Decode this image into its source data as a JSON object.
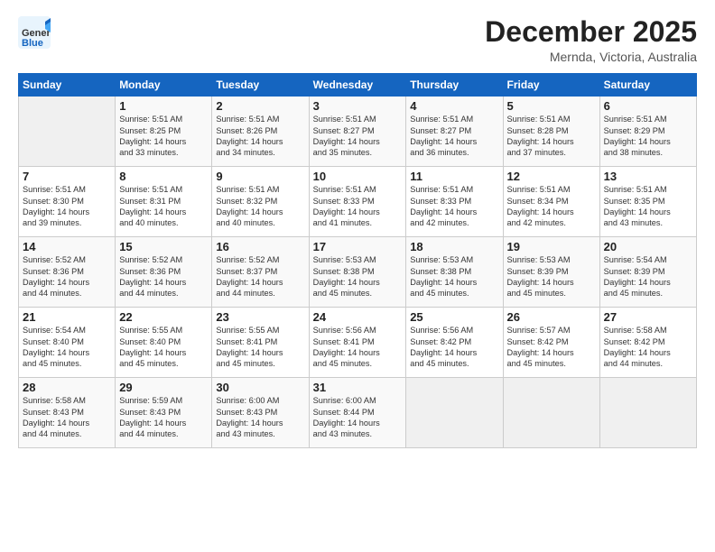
{
  "header": {
    "logo_line1": "General",
    "logo_line2": "Blue",
    "month_title": "December 2025",
    "location": "Mernda, Victoria, Australia"
  },
  "weekdays": [
    "Sunday",
    "Monday",
    "Tuesday",
    "Wednesday",
    "Thursday",
    "Friday",
    "Saturday"
  ],
  "weeks": [
    [
      {
        "day": "",
        "info": ""
      },
      {
        "day": "1",
        "info": "Sunrise: 5:51 AM\nSunset: 8:25 PM\nDaylight: 14 hours\nand 33 minutes."
      },
      {
        "day": "2",
        "info": "Sunrise: 5:51 AM\nSunset: 8:26 PM\nDaylight: 14 hours\nand 34 minutes."
      },
      {
        "day": "3",
        "info": "Sunrise: 5:51 AM\nSunset: 8:27 PM\nDaylight: 14 hours\nand 35 minutes."
      },
      {
        "day": "4",
        "info": "Sunrise: 5:51 AM\nSunset: 8:27 PM\nDaylight: 14 hours\nand 36 minutes."
      },
      {
        "day": "5",
        "info": "Sunrise: 5:51 AM\nSunset: 8:28 PM\nDaylight: 14 hours\nand 37 minutes."
      },
      {
        "day": "6",
        "info": "Sunrise: 5:51 AM\nSunset: 8:29 PM\nDaylight: 14 hours\nand 38 minutes."
      }
    ],
    [
      {
        "day": "7",
        "info": "Sunrise: 5:51 AM\nSunset: 8:30 PM\nDaylight: 14 hours\nand 39 minutes."
      },
      {
        "day": "8",
        "info": "Sunrise: 5:51 AM\nSunset: 8:31 PM\nDaylight: 14 hours\nand 40 minutes."
      },
      {
        "day": "9",
        "info": "Sunrise: 5:51 AM\nSunset: 8:32 PM\nDaylight: 14 hours\nand 40 minutes."
      },
      {
        "day": "10",
        "info": "Sunrise: 5:51 AM\nSunset: 8:33 PM\nDaylight: 14 hours\nand 41 minutes."
      },
      {
        "day": "11",
        "info": "Sunrise: 5:51 AM\nSunset: 8:33 PM\nDaylight: 14 hours\nand 42 minutes."
      },
      {
        "day": "12",
        "info": "Sunrise: 5:51 AM\nSunset: 8:34 PM\nDaylight: 14 hours\nand 42 minutes."
      },
      {
        "day": "13",
        "info": "Sunrise: 5:51 AM\nSunset: 8:35 PM\nDaylight: 14 hours\nand 43 minutes."
      }
    ],
    [
      {
        "day": "14",
        "info": "Sunrise: 5:52 AM\nSunset: 8:36 PM\nDaylight: 14 hours\nand 44 minutes."
      },
      {
        "day": "15",
        "info": "Sunrise: 5:52 AM\nSunset: 8:36 PM\nDaylight: 14 hours\nand 44 minutes."
      },
      {
        "day": "16",
        "info": "Sunrise: 5:52 AM\nSunset: 8:37 PM\nDaylight: 14 hours\nand 44 minutes."
      },
      {
        "day": "17",
        "info": "Sunrise: 5:53 AM\nSunset: 8:38 PM\nDaylight: 14 hours\nand 45 minutes."
      },
      {
        "day": "18",
        "info": "Sunrise: 5:53 AM\nSunset: 8:38 PM\nDaylight: 14 hours\nand 45 minutes."
      },
      {
        "day": "19",
        "info": "Sunrise: 5:53 AM\nSunset: 8:39 PM\nDaylight: 14 hours\nand 45 minutes."
      },
      {
        "day": "20",
        "info": "Sunrise: 5:54 AM\nSunset: 8:39 PM\nDaylight: 14 hours\nand 45 minutes."
      }
    ],
    [
      {
        "day": "21",
        "info": "Sunrise: 5:54 AM\nSunset: 8:40 PM\nDaylight: 14 hours\nand 45 minutes."
      },
      {
        "day": "22",
        "info": "Sunrise: 5:55 AM\nSunset: 8:40 PM\nDaylight: 14 hours\nand 45 minutes."
      },
      {
        "day": "23",
        "info": "Sunrise: 5:55 AM\nSunset: 8:41 PM\nDaylight: 14 hours\nand 45 minutes."
      },
      {
        "day": "24",
        "info": "Sunrise: 5:56 AM\nSunset: 8:41 PM\nDaylight: 14 hours\nand 45 minutes."
      },
      {
        "day": "25",
        "info": "Sunrise: 5:56 AM\nSunset: 8:42 PM\nDaylight: 14 hours\nand 45 minutes."
      },
      {
        "day": "26",
        "info": "Sunrise: 5:57 AM\nSunset: 8:42 PM\nDaylight: 14 hours\nand 45 minutes."
      },
      {
        "day": "27",
        "info": "Sunrise: 5:58 AM\nSunset: 8:42 PM\nDaylight: 14 hours\nand 44 minutes."
      }
    ],
    [
      {
        "day": "28",
        "info": "Sunrise: 5:58 AM\nSunset: 8:43 PM\nDaylight: 14 hours\nand 44 minutes."
      },
      {
        "day": "29",
        "info": "Sunrise: 5:59 AM\nSunset: 8:43 PM\nDaylight: 14 hours\nand 44 minutes."
      },
      {
        "day": "30",
        "info": "Sunrise: 6:00 AM\nSunset: 8:43 PM\nDaylight: 14 hours\nand 43 minutes."
      },
      {
        "day": "31",
        "info": "Sunrise: 6:00 AM\nSunset: 8:44 PM\nDaylight: 14 hours\nand 43 minutes."
      },
      {
        "day": "",
        "info": ""
      },
      {
        "day": "",
        "info": ""
      },
      {
        "day": "",
        "info": ""
      }
    ]
  ]
}
